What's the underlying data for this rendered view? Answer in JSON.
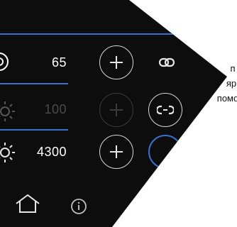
{
  "rows": [
    {
      "name": "row-brightness-main",
      "icon": "brightness-icon",
      "value": "65",
      "enabled": true,
      "link": "link-icon"
    },
    {
      "name": "row-brightness-dim",
      "icon": "sun-icon",
      "value": "100",
      "enabled": false,
      "link": "unlink-icon"
    },
    {
      "name": "row-color-temperature",
      "icon": "sun-icon",
      "value": "4300",
      "enabled": true,
      "link": null
    }
  ],
  "bottom_nav": {
    "home": "home-icon",
    "info": "info-icon"
  },
  "side_note": [
    "п",
    "яр",
    "помо"
  ],
  "colors": {
    "accent": "#3a6fcf",
    "panel": "#0d0d0d",
    "text": "#ffffff",
    "dim": "#4b4b4b"
  }
}
